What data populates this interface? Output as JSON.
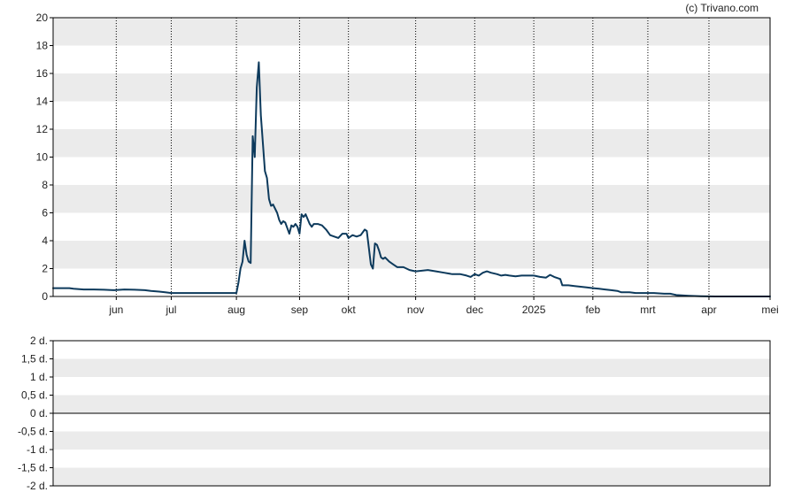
{
  "copyright": "(c) Trivano.com",
  "colors": {
    "line": "#0d3a5c",
    "band": "#ebebeb",
    "frame": "#000000",
    "grid": "#000000",
    "zero_line": "#000000"
  },
  "chart_data": [
    {
      "type": "line",
      "title": "",
      "xlabel": "",
      "ylabel": "",
      "ylim": [
        0,
        20
      ],
      "y_ticks": [
        "0",
        "2",
        "4",
        "6",
        "8",
        "10",
        "12",
        "14",
        "16",
        "18",
        "20"
      ],
      "x_range_days": [
        0,
        352
      ],
      "x_ticks": [
        {
          "label": "jun",
          "day": 31
        },
        {
          "label": "jul",
          "day": 58
        },
        {
          "label": "aug",
          "day": 90
        },
        {
          "label": "sep",
          "day": 121
        },
        {
          "label": "okt",
          "day": 145
        },
        {
          "label": "nov",
          "day": 178
        },
        {
          "label": "dec",
          "day": 207
        },
        {
          "label": "2025",
          "day": 236
        },
        {
          "label": "feb",
          "day": 265
        },
        {
          "label": "mrt",
          "day": 292
        },
        {
          "label": "apr",
          "day": 322
        },
        {
          "label": "mei",
          "day": 352
        }
      ],
      "grid": "vertical dotted at month ticks, alternating horizontal bands",
      "series": [
        {
          "values": [
            [
              0,
              0.6
            ],
            [
              8,
              0.6
            ],
            [
              10,
              0.55
            ],
            [
              15,
              0.5
            ],
            [
              20,
              0.5
            ],
            [
              25,
              0.48
            ],
            [
              30,
              0.45
            ],
            [
              35,
              0.5
            ],
            [
              40,
              0.48
            ],
            [
              45,
              0.45
            ],
            [
              48,
              0.4
            ],
            [
              52,
              0.35
            ],
            [
              55,
              0.3
            ],
            [
              58,
              0.25
            ],
            [
              65,
              0.25
            ],
            [
              75,
              0.25
            ],
            [
              85,
              0.25
            ],
            [
              90,
              0.25
            ],
            [
              91,
              1.0
            ],
            [
              92,
              2.0
            ],
            [
              93,
              2.5
            ],
            [
              94,
              4.0
            ],
            [
              95,
              3.0
            ],
            [
              96,
              2.5
            ],
            [
              97,
              2.4
            ],
            [
              98,
              11.5
            ],
            [
              99,
              10.0
            ],
            [
              100,
              15.0
            ],
            [
              101,
              16.8
            ],
            [
              102,
              13.0
            ],
            [
              103,
              11.0
            ],
            [
              104,
              9.0
            ],
            [
              105,
              8.5
            ],
            [
              106,
              7.0
            ],
            [
              107,
              6.5
            ],
            [
              108,
              6.6
            ],
            [
              110,
              6.0
            ],
            [
              111,
              5.5
            ],
            [
              112,
              5.2
            ],
            [
              113,
              5.4
            ],
            [
              114,
              5.3
            ],
            [
              115,
              4.9
            ],
            [
              116,
              4.5
            ],
            [
              117,
              5.1
            ],
            [
              118,
              5.0
            ],
            [
              119,
              5.2
            ],
            [
              120,
              5.0
            ],
            [
              121,
              4.5
            ],
            [
              122,
              5.9
            ],
            [
              123,
              5.7
            ],
            [
              124,
              5.9
            ],
            [
              126,
              5.2
            ],
            [
              127,
              5.0
            ],
            [
              128,
              5.2
            ],
            [
              130,
              5.2
            ],
            [
              132,
              5.1
            ],
            [
              134,
              4.8
            ],
            [
              136,
              4.4
            ],
            [
              138,
              4.3
            ],
            [
              140,
              4.2
            ],
            [
              142,
              4.5
            ],
            [
              144,
              4.5
            ],
            [
              145,
              4.2
            ],
            [
              147,
              4.4
            ],
            [
              149,
              4.3
            ],
            [
              151,
              4.4
            ],
            [
              153,
              4.8
            ],
            [
              154,
              4.7
            ],
            [
              155,
              3.5
            ],
            [
              156,
              2.3
            ],
            [
              157,
              2.0
            ],
            [
              158,
              3.8
            ],
            [
              159,
              3.7
            ],
            [
              160,
              3.3
            ],
            [
              161,
              2.8
            ],
            [
              162,
              2.7
            ],
            [
              163,
              2.8
            ],
            [
              165,
              2.5
            ],
            [
              167,
              2.3
            ],
            [
              169,
              2.1
            ],
            [
              172,
              2.1
            ],
            [
              175,
              1.9
            ],
            [
              178,
              1.8
            ],
            [
              181,
              1.85
            ],
            [
              184,
              1.9
            ],
            [
              188,
              1.8
            ],
            [
              192,
              1.7
            ],
            [
              196,
              1.6
            ],
            [
              200,
              1.6
            ],
            [
              203,
              1.5
            ],
            [
              205,
              1.4
            ],
            [
              207,
              1.6
            ],
            [
              209,
              1.5
            ],
            [
              211,
              1.7
            ],
            [
              213,
              1.8
            ],
            [
              215,
              1.7
            ],
            [
              218,
              1.6
            ],
            [
              220,
              1.5
            ],
            [
              222,
              1.55
            ],
            [
              224,
              1.5
            ],
            [
              227,
              1.45
            ],
            [
              230,
              1.5
            ],
            [
              233,
              1.5
            ],
            [
              236,
              1.5
            ],
            [
              239,
              1.4
            ],
            [
              242,
              1.35
            ],
            [
              244,
              1.55
            ],
            [
              246,
              1.4
            ],
            [
              249,
              1.25
            ],
            [
              250,
              0.8
            ],
            [
              253,
              0.8
            ],
            [
              256,
              0.75
            ],
            [
              259,
              0.7
            ],
            [
              262,
              0.65
            ],
            [
              265,
              0.6
            ],
            [
              268,
              0.55
            ],
            [
              271,
              0.5
            ],
            [
              274,
              0.45
            ],
            [
              277,
              0.4
            ],
            [
              279,
              0.3
            ],
            [
              283,
              0.3
            ],
            [
              286,
              0.25
            ],
            [
              290,
              0.25
            ],
            [
              295,
              0.25
            ],
            [
              300,
              0.2
            ],
            [
              303,
              0.2
            ],
            [
              306,
              0.1
            ],
            [
              312,
              0.05
            ],
            [
              318,
              0.02
            ],
            [
              325,
              0.0
            ],
            [
              330,
              0.0
            ],
            [
              335,
              0.0
            ],
            [
              340,
              0.0
            ],
            [
              345,
              0.0
            ],
            [
              352,
              0.0
            ]
          ]
        }
      ]
    },
    {
      "type": "line",
      "title": "",
      "xlabel": "",
      "ylabel": "",
      "ylim": [
        -2,
        2
      ],
      "y_ticks": [
        "2 d.",
        "1,5 d.",
        "1 d.",
        "0,5 d.",
        "0 d.",
        "-0,5 d.",
        "-1 d.",
        "-1,5 d.",
        "-2 d."
      ],
      "grid": "alternating horizontal bands, solid zero line",
      "series": []
    }
  ]
}
